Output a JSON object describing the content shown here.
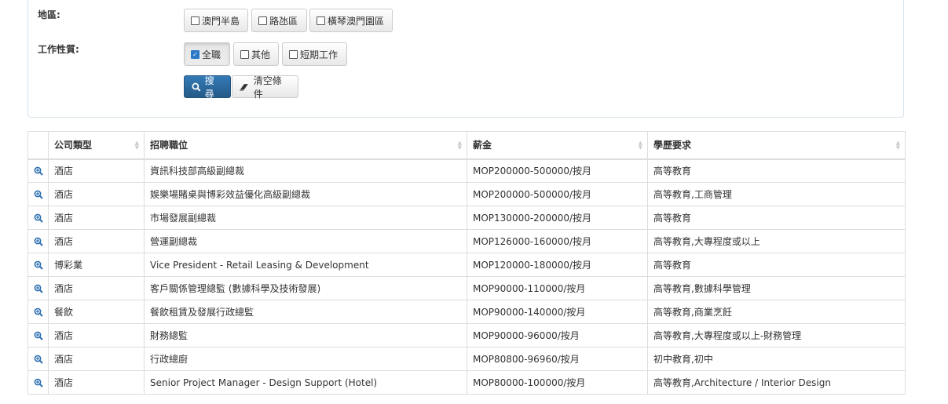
{
  "filters": {
    "region": {
      "label": "地區:",
      "options": [
        {
          "label": "澳門半島",
          "checked": false
        },
        {
          "label": "路氹區",
          "checked": false
        },
        {
          "label": "橫琴澳門園區",
          "checked": false
        }
      ]
    },
    "job_nature": {
      "label": "工作性質:",
      "options": [
        {
          "label": "全職",
          "checked": true
        },
        {
          "label": "其他",
          "checked": false
        },
        {
          "label": "短期工作",
          "checked": false
        }
      ]
    },
    "search_button": "搜尋",
    "clear_button": "清空條件"
  },
  "table": {
    "headers": {
      "company_type": "公司類型",
      "position": "招聘職位",
      "salary": "薪金",
      "education": "學歷要求"
    },
    "rows": [
      {
        "company_type": "酒店",
        "position": "資訊科技部高級副總裁",
        "salary": "MOP200000-500000/按月",
        "education": "高等教育"
      },
      {
        "company_type": "酒店",
        "position": "娛樂場賭桌與博彩效益優化高級副總裁",
        "salary": "MOP200000-500000/按月",
        "education": "高等教育,工商管理"
      },
      {
        "company_type": "酒店",
        "position": "市場發展副總裁",
        "salary": "MOP130000-200000/按月",
        "education": "高等教育"
      },
      {
        "company_type": "酒店",
        "position": "營運副總裁",
        "salary": "MOP126000-160000/按月",
        "education": "高等教育,大專程度或以上"
      },
      {
        "company_type": "博彩業",
        "position": "Vice President - Retail Leasing & Development",
        "salary": "MOP120000-180000/按月",
        "education": "高等教育"
      },
      {
        "company_type": "酒店",
        "position": "客戶關係管理總監 (數據科學及技術發展)",
        "salary": "MOP90000-110000/按月",
        "education": "高等教育,數據科學管理"
      },
      {
        "company_type": "餐飲",
        "position": "餐飲租賃及發展行政總監",
        "salary": "MOP90000-140000/按月",
        "education": "高等教育,商業烹飪"
      },
      {
        "company_type": "酒店",
        "position": "財務總監",
        "salary": "MOP90000-96000/按月",
        "education": "高等教育,大專程度或以上-財務管理"
      },
      {
        "company_type": "酒店",
        "position": "行政總廚",
        "salary": "MOP80800-96960/按月",
        "education": "初中教育,初中"
      },
      {
        "company_type": "酒店",
        "position": "Senior Project Manager - Design Support (Hotel)",
        "salary": "MOP80000-100000/按月",
        "education": "高等教育,Architecture / Interior Design"
      }
    ]
  },
  "colors": {
    "primary": "#337ab7",
    "icon": "#2a6db0",
    "border": "#dddddd"
  },
  "icons": {
    "row_detail": "zoom-in-icon",
    "search": "search-icon",
    "clear": "eraser-icon",
    "sort": "sort-icon"
  }
}
